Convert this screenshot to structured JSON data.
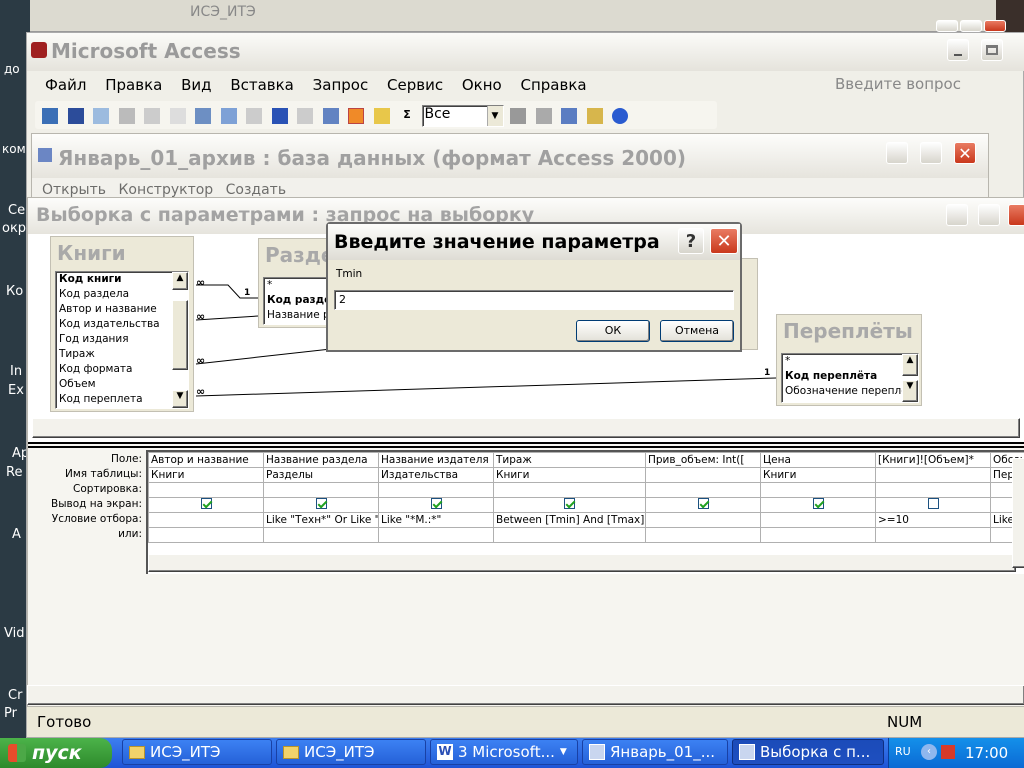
{
  "desktop_labels": [
    "до",
    "ком",
    "Се",
    "окр",
    "Ко",
    "In",
    "Ex",
    "Ар",
    "Re",
    "А",
    "Vid",
    "Cr",
    "Pr"
  ],
  "bg_windows": {
    "title": "ИСЭ_ИТЭ"
  },
  "app": {
    "title": "Microsoft Access",
    "menu": [
      "Файл",
      "Правка",
      "Вид",
      "Вставка",
      "Запрос",
      "Сервис",
      "Окно",
      "Справка"
    ],
    "help_placeholder": "Введите вопрос",
    "toolbar_combo": "Все",
    "status": "Готово",
    "status_num": "NUM"
  },
  "db_window": {
    "title": "Январь_01_архив : база данных (формат Access 2000)",
    "toolbar": [
      "Открыть",
      "Конструктор",
      "Создать"
    ]
  },
  "query_window": {
    "title": "Выборка с параметрами : запрос на выборку",
    "tables": {
      "books": {
        "title": "Книги",
        "fields": [
          "Код книги",
          "Код раздела",
          "Автор и название",
          "Код издательства",
          "Год издания",
          "Тираж",
          "Код формата",
          "Объем",
          "Код переплета"
        ]
      },
      "sections": {
        "title": "Разде",
        "fields": [
          "*",
          "Код раздела",
          "Название раз"
        ]
      },
      "bindings": {
        "title": "Переплёты",
        "fields": [
          "*",
          "Код переплёта",
          "Обозначение переплё"
        ]
      }
    },
    "join_labels": {
      "one": "1",
      "many": "∞"
    },
    "grid": {
      "row_labels": [
        "Поле:",
        "Имя таблицы:",
        "Сортировка:",
        "Вывод на экран:",
        "Условие отбора:",
        "или:"
      ],
      "columns": [
        {
          "field": "Автор и название",
          "table": "Книги",
          "show": true,
          "criteria": ""
        },
        {
          "field": "Название раздела",
          "table": "Разделы",
          "show": true,
          "criteria": "Like \"Техн*\" Or Like \"Ко"
        },
        {
          "field": "Название издателя",
          "table": "Издательства",
          "show": true,
          "criteria": "Like \"*М.:*\""
        },
        {
          "field": "Тираж",
          "table": "Книги",
          "show": true,
          "criteria": "Between [Tmin] And [Tmax]"
        },
        {
          "field": "Прив_объем: Int([",
          "table": "",
          "show": true,
          "criteria": ""
        },
        {
          "field": "Цена",
          "table": "Книги",
          "show": true,
          "criteria": ""
        },
        {
          "field": "[Книги]![Объем]*",
          "table": "",
          "show": false,
          "criteria": ">=10"
        },
        {
          "field": "Обозн",
          "table": "Пере",
          "show": true,
          "criteria": "Like '"
        }
      ]
    }
  },
  "dialog": {
    "title": "Введите значение параметра",
    "prompt": "Tmin",
    "value": "2",
    "ok": "ОК",
    "cancel": "Отмена"
  },
  "taskbar": {
    "start": "пуск",
    "items": [
      "ИСЭ_ИТЭ",
      "ИСЭ_ИТЭ",
      "3 Microsoft...",
      "Январь_01_...",
      "Выборка с п..."
    ],
    "lang": "RU",
    "time": "17:00"
  }
}
